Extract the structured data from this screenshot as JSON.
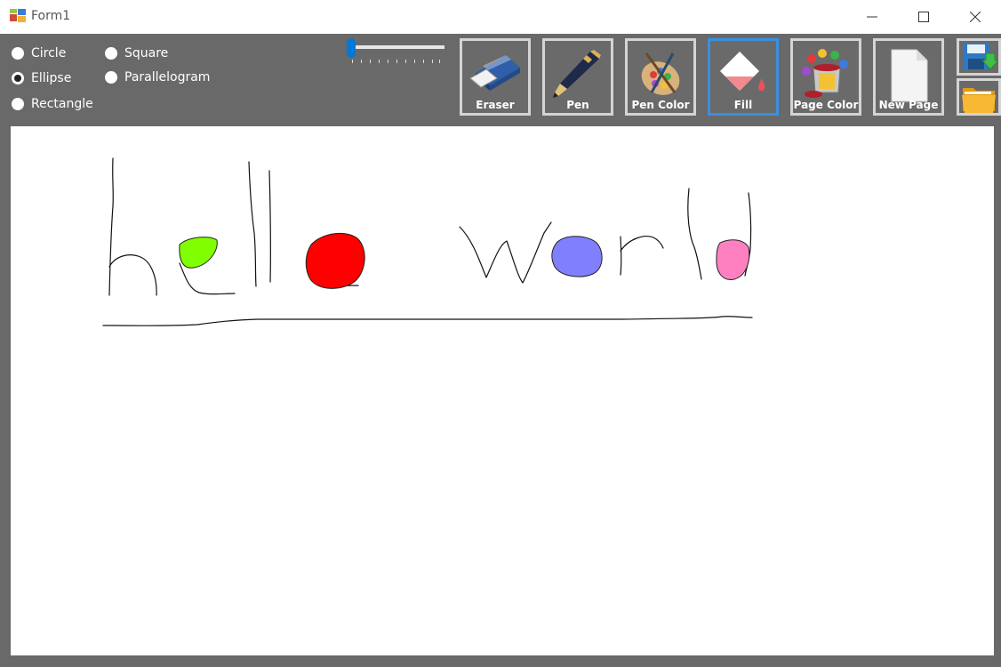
{
  "window": {
    "title": "Form1"
  },
  "shapes": {
    "options": [
      {
        "label": "Circle",
        "checked": false
      },
      {
        "label": "Ellipse",
        "checked": true
      },
      {
        "label": "Rectangle",
        "checked": false
      },
      {
        "label": "Square",
        "checked": false
      },
      {
        "label": "Parallelogram",
        "checked": false
      }
    ]
  },
  "pen_size": {
    "value": 0
  },
  "tools": [
    {
      "label": "Eraser",
      "icon": "eraser-icon"
    },
    {
      "label": "Pen",
      "icon": "pen-icon"
    },
    {
      "label": "Pen Color",
      "icon": "palette-icon"
    },
    {
      "label": "Fill",
      "icon": "fill-bucket-icon",
      "active": true
    },
    {
      "label": "Page Color",
      "icon": "paint-can-icon"
    },
    {
      "label": "New Page",
      "icon": "blank-page-icon"
    }
  ],
  "file_buttons": {
    "save_icon": "save-icon",
    "open_icon": "folder-open-icon"
  },
  "colors": {
    "toolbar": "#696969",
    "active_border": "#3b8fe0",
    "fill_green": "#80ff00",
    "fill_red": "#ff0000",
    "fill_blue": "#8080ff",
    "fill_pink": "#ff80c0"
  },
  "canvas": {
    "drawing": "hello world"
  }
}
